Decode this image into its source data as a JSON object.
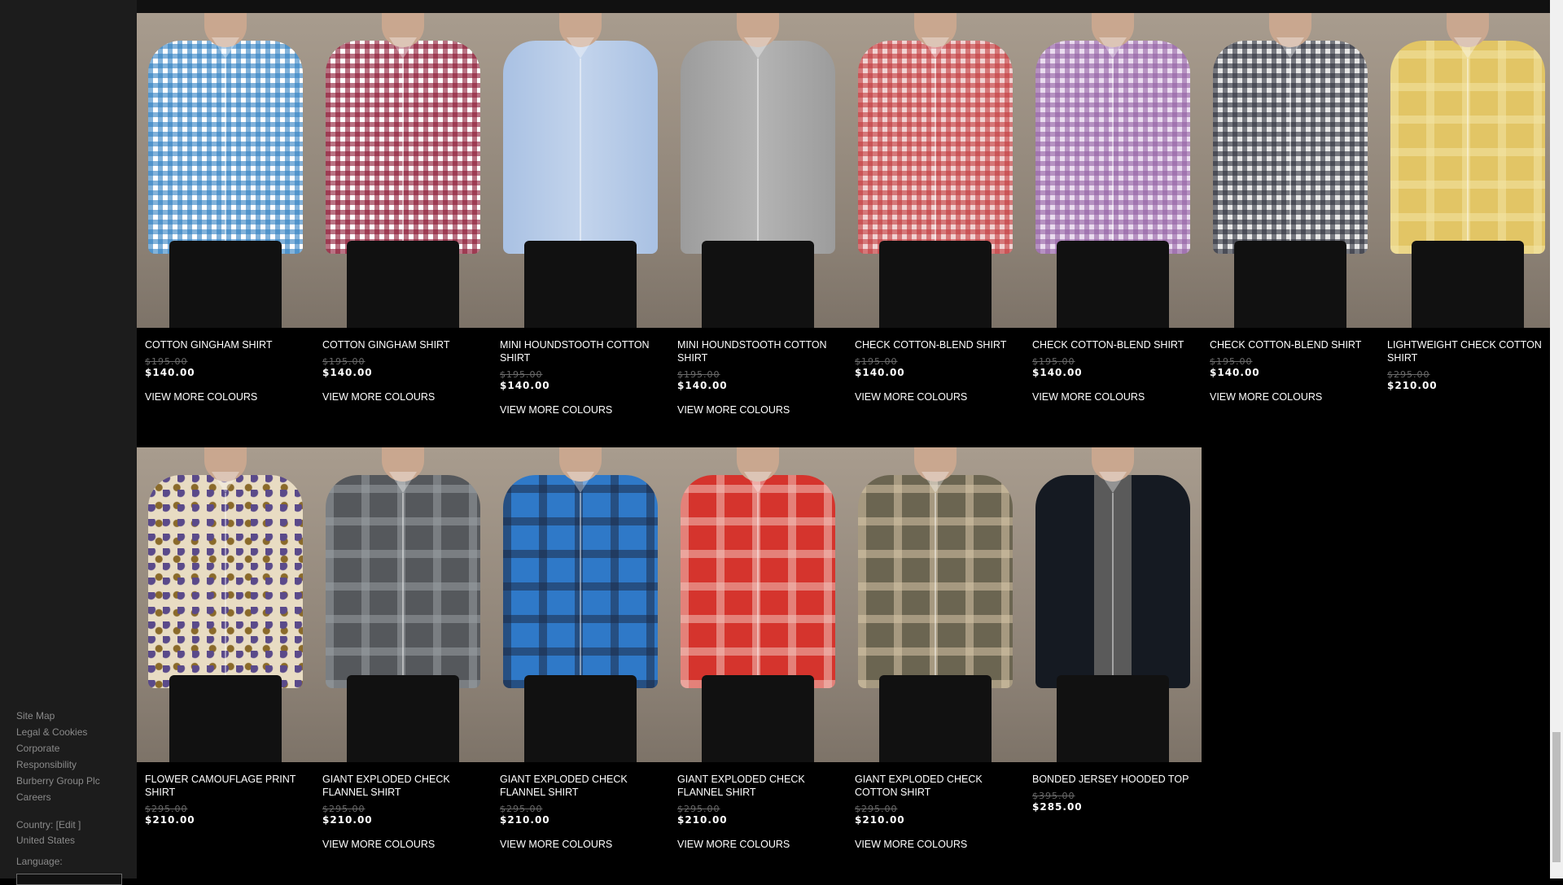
{
  "sidebar": {
    "links": [
      "Site Map",
      "Legal & Cookies",
      "Corporate",
      "Responsibility",
      "Burberry Group Plc",
      "Careers"
    ],
    "country_label": "Country: [",
    "country_edit": "Edit",
    "country_close": " ]",
    "country_value": "United States",
    "language_label": "Language:"
  },
  "products": [
    {
      "name": "COTTON GINGHAM SHIRT",
      "old_price": "$195.00",
      "price": "$140.00",
      "more": "VIEW MORE COLOURS",
      "colors": [
        "#2f7fc1",
        "#ffffff"
      ],
      "pattern": "gingham"
    },
    {
      "name": "COTTON GINGHAM SHIRT",
      "old_price": "$195.00",
      "price": "$140.00",
      "more": "VIEW MORE COLOURS",
      "colors": [
        "#8a1631",
        "#ffffff"
      ],
      "pattern": "gingham"
    },
    {
      "name": "MINI HOUNDSTOOTH COTTON SHIRT",
      "old_price": "$195.00",
      "price": "$140.00",
      "more": "VIEW MORE COLOURS",
      "colors": [
        "#a9c1e3",
        "#c3d4ec"
      ],
      "pattern": "solid"
    },
    {
      "name": "MINI HOUNDSTOOTH COTTON SHIRT",
      "old_price": "$195.00",
      "price": "$140.00",
      "more": "VIEW MORE COLOURS",
      "colors": [
        "#9c9c9c",
        "#b4b4b4"
      ],
      "pattern": "solid"
    },
    {
      "name": "CHECK COTTON-BLEND SHIRT",
      "old_price": "$195.00",
      "price": "$140.00",
      "more": "VIEW MORE COLOURS",
      "colors": [
        "#c23b3e",
        "#f1d2d2"
      ],
      "pattern": "gingham"
    },
    {
      "name": "CHECK COTTON-BLEND SHIRT",
      "old_price": "$195.00",
      "price": "$140.00",
      "more": "VIEW MORE COLOURS",
      "colors": [
        "#9360a3",
        "#eadcef"
      ],
      "pattern": "gingham"
    },
    {
      "name": "CHECK COTTON-BLEND SHIRT",
      "old_price": "$195.00",
      "price": "$140.00",
      "more": "VIEW MORE COLOURS",
      "colors": [
        "#2c2f3a",
        "#e6e6e6"
      ],
      "pattern": "gingham"
    },
    {
      "name": "LIGHTWEIGHT CHECK COTTON SHIRT",
      "old_price": "$295.00",
      "price": "$210.00",
      "more": "",
      "colors": [
        "#e2c565",
        "#f3e4a6"
      ],
      "pattern": "check"
    },
    {
      "name": "FLOWER CAMOUFLAGE PRINT SHIRT",
      "old_price": "$295.00",
      "price": "$210.00",
      "more": "",
      "colors": [
        "#e8dcc3",
        "#5a4a8a"
      ],
      "pattern": "print"
    },
    {
      "name": "GIANT EXPLODED CHECK FLANNEL SHIRT",
      "old_price": "$295.00",
      "price": "$210.00",
      "more": "VIEW MORE COLOURS",
      "colors": [
        "#55585c",
        "#9aa0a3"
      ],
      "pattern": "check"
    },
    {
      "name": "GIANT EXPLODED CHECK FLANNEL SHIRT",
      "old_price": "$295.00",
      "price": "$210.00",
      "more": "VIEW MORE COLOURS",
      "colors": [
        "#2f79c8",
        "#1d2a44"
      ],
      "pattern": "check"
    },
    {
      "name": "GIANT EXPLODED CHECK FLANNEL SHIRT",
      "old_price": "$295.00",
      "price": "$210.00",
      "more": "VIEW MORE COLOURS",
      "colors": [
        "#d5342d",
        "#f1c4bc"
      ],
      "pattern": "check"
    },
    {
      "name": "GIANT EXPLODED CHECK COTTON SHIRT",
      "old_price": "$295.00",
      "price": "$210.00",
      "more": "VIEW MORE COLOURS",
      "colors": [
        "#6b6551",
        "#d9c7a9"
      ],
      "pattern": "check"
    },
    {
      "name": "BONDED JERSEY HOODED TOP",
      "old_price": "$395.00",
      "price": "$285.00",
      "more": "",
      "colors": [
        "#151a22",
        "#5a5a5a"
      ],
      "pattern": "jacket"
    }
  ]
}
